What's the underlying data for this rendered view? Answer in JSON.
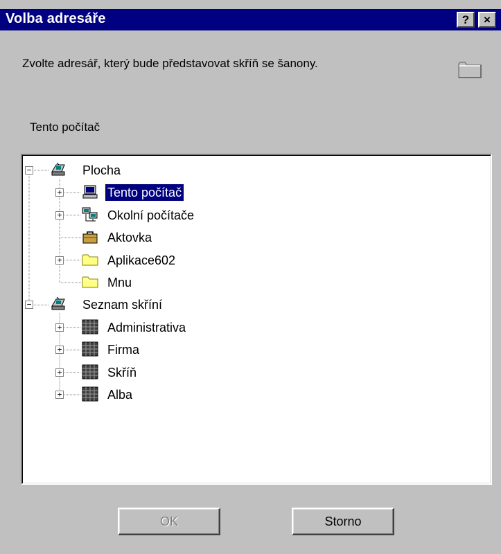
{
  "dialog": {
    "title": "Volba adresáře",
    "help_label": "?",
    "close_label": "×",
    "prompt": "Zvolte adresář, který bude představovat skříň se šanony.",
    "current_selection": "Tento počítač"
  },
  "tree": {
    "nodes": [
      {
        "label": "Plocha",
        "icon": "desktop-icon",
        "expander": "−"
      },
      {
        "label": "Tento počítač",
        "icon": "computer-icon",
        "expander": "+",
        "selected": true
      },
      {
        "label": "Okolní počítače",
        "icon": "network-icon",
        "expander": "+"
      },
      {
        "label": "Aktovka",
        "icon": "briefcase-icon"
      },
      {
        "label": "Aplikace602",
        "icon": "folder-icon",
        "expander": "+"
      },
      {
        "label": "Mnu",
        "icon": "folder-icon"
      },
      {
        "label": "Seznam skříní",
        "icon": "desktop-icon",
        "expander": "−"
      },
      {
        "label": "Administrativa",
        "icon": "cabinet-icon",
        "expander": "+"
      },
      {
        "label": "Firma",
        "icon": "cabinet-icon",
        "expander": "+"
      },
      {
        "label": "Skříň",
        "icon": "cabinet-icon",
        "expander": "+"
      },
      {
        "label": "Alba",
        "icon": "cabinet-icon",
        "expander": "+"
      }
    ]
  },
  "buttons": {
    "ok_label": "OK",
    "ok_enabled": false,
    "cancel_label": "Storno"
  },
  "colors": {
    "title_bar": "#000080",
    "face": "#c0c0c0",
    "selection": "#000080",
    "folder_yellow": "#ffff80"
  }
}
